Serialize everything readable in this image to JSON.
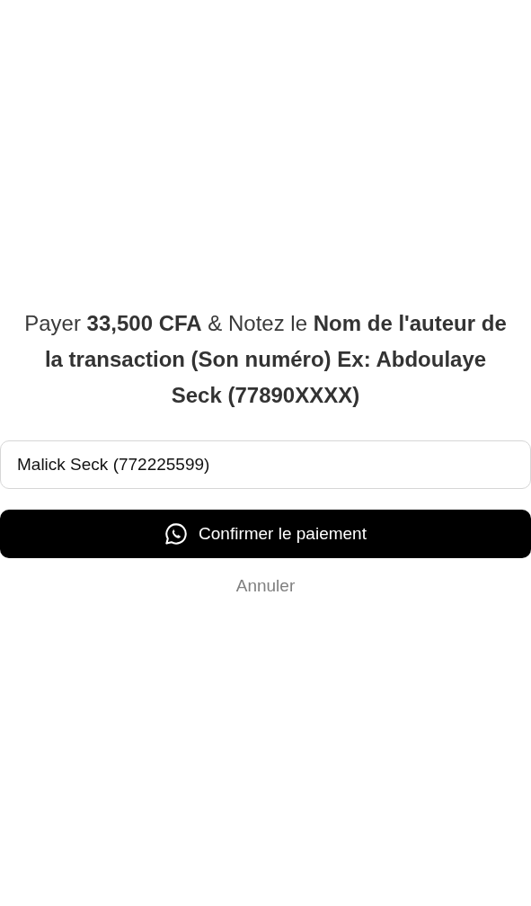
{
  "instruction": "Payer **33,500 CFA** & Notez le **Nom de l'auteur de la transaction (Son numéro) Ex: Abdoulaye Seck (77890XXXX)**",
  "name_field": {
    "value": "Malick Seck (772225599)"
  },
  "confirm_button": {
    "label": "Confirmer le paiement"
  },
  "cancel_link": {
    "label": "Annuler"
  }
}
